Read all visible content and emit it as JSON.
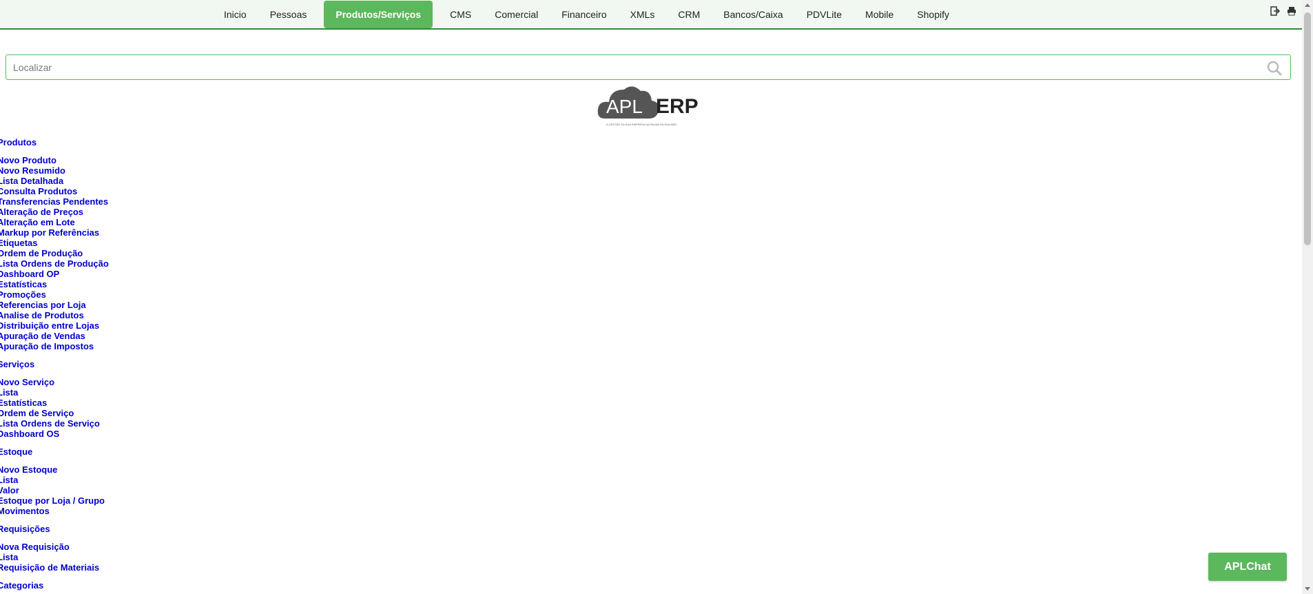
{
  "nav": {
    "items": [
      {
        "label": "Inicio",
        "active": false
      },
      {
        "label": "Pessoas",
        "active": false
      },
      {
        "label": "Produtos/Serviços",
        "active": true
      },
      {
        "label": "CMS",
        "active": false
      },
      {
        "label": "Comercial",
        "active": false
      },
      {
        "label": "Financeiro",
        "active": false
      },
      {
        "label": "XMLs",
        "active": false
      },
      {
        "label": "CRM",
        "active": false
      },
      {
        "label": "Bancos/Caixa",
        "active": false
      },
      {
        "label": "PDVLite",
        "active": false
      },
      {
        "label": "Mobile",
        "active": false
      },
      {
        "label": "Shopify",
        "active": false
      }
    ],
    "icons": [
      "logout-icon",
      "print-icon"
    ]
  },
  "search": {
    "placeholder": "Localizar"
  },
  "logo": {
    "apl": "APL",
    "erp": "ERP",
    "tagline": "A GESTÃO DA SUA EMPRESA NA PALMA DA SUA MÃO"
  },
  "menu": {
    "sections": [
      {
        "title": "Produtos",
        "links": [
          "Novo Produto",
          "Novo Resumido",
          "Lista Detalhada",
          "Consulta Produtos",
          "Transferencias Pendentes",
          "Alteração de Preços",
          "Alteração em Lote",
          "Markup por Referências",
          "Etiquetas",
          "Ordem de Produção",
          "Lista Ordens de Produção",
          "Dashboard OP",
          "Estatísticas",
          "Promoções",
          "Referencias por Loja",
          "Analise de Produtos",
          "Distribuição entre Lojas",
          "Apuração de Vendas",
          "Apuração de Impostos"
        ]
      },
      {
        "title": "Serviços",
        "links": [
          "Novo Serviço",
          "Lista",
          "Estatísticas",
          "Ordem de Serviço",
          "Lista Ordens de Serviço",
          "Dashboard OS"
        ]
      },
      {
        "title": "Estoque",
        "links": [
          "Novo Estoque",
          "Lista",
          "Valor",
          "Estoque por Loja / Grupo",
          "Movimentos"
        ]
      },
      {
        "title": "Requisições",
        "links": [
          "Nova Requisição",
          "Lista",
          "Requisição de Materiais"
        ]
      },
      {
        "title": "Categorias",
        "links": []
      }
    ]
  },
  "chat": {
    "label": "APLChat"
  },
  "colors": {
    "accent": "#5cb85c",
    "link": "#0000cc",
    "nav_border": "#2e8b3e"
  }
}
